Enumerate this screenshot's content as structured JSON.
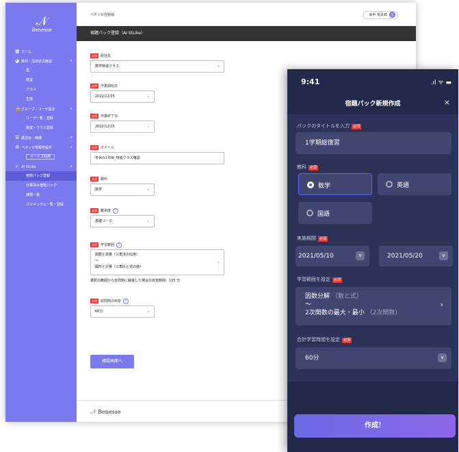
{
  "desktop": {
    "logo": {
      "mark": "𝒩",
      "text": "Benesse"
    },
    "nav": [
      {
        "icon": "▦",
        "label": "ホーム",
        "type": "top"
      },
      {
        "icon": "◕",
        "label": "教材・活用状況確認",
        "type": "top",
        "chev": "∧"
      },
      {
        "label": "塾",
        "type": "sub"
      },
      {
        "label": "教室",
        "type": "sub"
      },
      {
        "label": "クラス",
        "type": "sub"
      },
      {
        "label": "生徒",
        "type": "sub"
      },
      {
        "icon": "🔒",
        "label": "グループ・ユーザ設定",
        "type": "top",
        "chev": "∧"
      },
      {
        "label": "ユーザ一覧・登録",
        "type": "sub"
      },
      {
        "label": "教室・クラス登録",
        "type": "sub"
      },
      {
        "icon": "☰",
        "label": "講習会・時期",
        "type": "top",
        "chev": "∨"
      },
      {
        "icon": "⚙",
        "label": "ベネッセ情報校設定",
        "type": "top",
        "chev": "∨"
      },
      {
        "label": "サービス利用",
        "type": "box"
      },
      {
        "icon": "✓",
        "label": "AI StLike",
        "type": "top",
        "chev": "∧"
      },
      {
        "label": "宿題パック登録",
        "type": "active"
      },
      {
        "label": "計算済み宿題パック",
        "type": "sub"
      },
      {
        "label": "課題一覧",
        "type": "sub"
      },
      {
        "label": "カリキュラム一覧・登録",
        "type": "sub"
      }
    ],
    "org": "ベネッセ自塾版",
    "user": "会手 花太郎",
    "avatar": "田",
    "page_title": "宿題パック登録（AI StLike）",
    "req": "必須",
    "form": {
      "target_label": "配信先",
      "target_value": "数学特進クラス",
      "start_label": "作業開始日",
      "start_value": "2022/12/25",
      "end_label": "作業終了日",
      "end_value": "2022/12/25",
      "title_label": "タイトル",
      "title_value": "冬休み1日目_特進クラス確認",
      "subject_label": "教科",
      "subject_value": "数学",
      "course_label": "難易度",
      "course_value": "基礎コース",
      "range_label": "学習範囲",
      "range_line1": "関数と単量（三角法の応用）",
      "range_line2": "〜",
      "range_line3": "図形と計量（三角比と式の値）",
      "range_note": "選択の範囲から全問題に解答した場合の目安時間：135 分",
      "time_label": "総問題の目安",
      "time_value": "60分",
      "submit": "確認画面へ"
    },
    "footer_logo": "Benesse",
    "footer_mark": "𝒩"
  },
  "mobile": {
    "time": "9:41",
    "signal": ".ıl ᯤ ▬",
    "title": "宿題パック新規作成",
    "close": "×",
    "req": "必須",
    "title_label": "パックのタイトルを入力",
    "title_value": "1学期総復習",
    "subject_label": "教科",
    "subjects": [
      "数学",
      "英語",
      "国語"
    ],
    "period_label": "実施期間",
    "start": "2021/05/10",
    "end": "2021/05/20",
    "range_label": "学習範囲を設定",
    "range_from": "因数分解",
    "range_from_sub": "（数と式）",
    "range_tilde": "〜",
    "range_to": "2次関数の最大・最小",
    "range_to_sub": "（2次関数）",
    "time_label": "合計学習時間を設定",
    "time_value": "60分",
    "create": "作成！"
  }
}
